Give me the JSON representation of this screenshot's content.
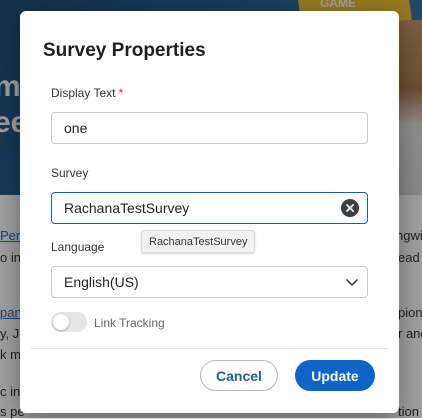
{
  "background": {
    "hero_text_1": "m",
    "hero_text_2": "ee",
    "hero_badge": "GAME",
    "lines": [
      {
        "text": "Per",
        "right": "ngwi"
      },
      {
        "text": "o in",
        "right": "ead"
      },
      {
        "text": "pan",
        "right": "pion"
      },
      {
        "text": "y, J",
        "right": "r and"
      },
      {
        "text": "k m",
        "right": ""
      },
      {
        "text": "c inv",
        "right": ""
      },
      {
        "text": "s pe",
        "right": "tion"
      }
    ]
  },
  "dialog": {
    "title": "Survey Properties",
    "display_text": {
      "label": "Display Text",
      "required_mark": "*",
      "value": "one"
    },
    "survey": {
      "label": "Survey",
      "value": "RachanaTestSurvey",
      "tooltip": "RachanaTestSurvey"
    },
    "language": {
      "label": "Language",
      "selected": "English(US)"
    },
    "link_tracking": {
      "label": "Link Tracking",
      "enabled": false
    },
    "buttons": {
      "cancel": "Cancel",
      "update": "Update"
    }
  },
  "colors": {
    "primary": "#0f64c8",
    "focus_border": "#1d5fa3",
    "required": "#d93025"
  }
}
